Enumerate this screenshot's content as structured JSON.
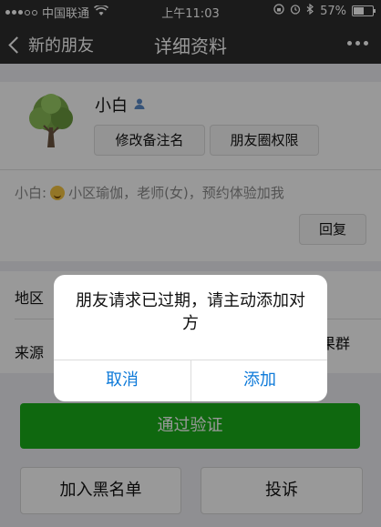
{
  "status_bar": {
    "carrier": "中国联通",
    "time": "上午11:03",
    "battery": "57%",
    "battery_level": 0.57
  },
  "nav": {
    "back_label": "新的朋友",
    "title": "详细资料"
  },
  "profile": {
    "name": "小白",
    "buttons": {
      "remark": "修改备注名",
      "moments_permission": "朋友圈权限"
    }
  },
  "message": {
    "sender": "小白:",
    "text": "小区瑜伽，老师(女)，预约体验加我",
    "reply_label": "回复"
  },
  "info": {
    "region_label": "地区",
    "source_label": "来源",
    "source_value_partial": "果群"
  },
  "actions": {
    "accept": "通过验证",
    "blacklist": "加入黑名单",
    "report": "投诉"
  },
  "dialog": {
    "message": "朋友请求已过期，请主动添加对方",
    "cancel": "取消",
    "add": "添加"
  },
  "colors": {
    "nav_bg": "#2e2e2e",
    "accent_green": "#1aad19",
    "dialog_button": "#0e7ad9"
  }
}
